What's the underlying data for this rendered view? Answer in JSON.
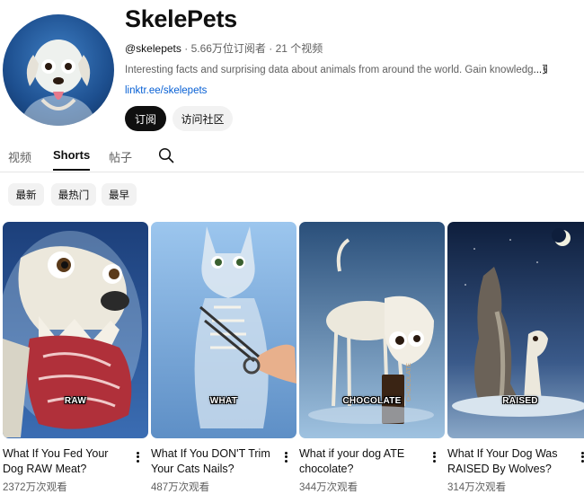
{
  "channel": {
    "name": "SkelePets",
    "handle": "@skelepets",
    "subscribers": "5.66万位订阅者",
    "videos": "21 个视频",
    "separator": "·",
    "description": "Interesting facts and surprising data about animals from around the world. Gain knowledg",
    "more": "...更多",
    "link": "linktr.ee/skelepets"
  },
  "buttons": {
    "subscribe": "订阅",
    "community": "访问社区"
  },
  "tabs": [
    "视频",
    "Shorts",
    "帖子"
  ],
  "active_tab": "Shorts",
  "filters": [
    "最新",
    "最热门",
    "最早"
  ],
  "shorts": [
    {
      "title": "What If You Fed Your Dog RAW Meat?",
      "views": "2372万次观看",
      "overlay": "RAW"
    },
    {
      "title": "What If You DON'T Trim Your Cats Nails?",
      "views": "487万次观看",
      "overlay": "WHAT"
    },
    {
      "title": "What if your dog ATE chocolate?",
      "views": "344万次观看",
      "overlay": "CHOCOLATE",
      "bar_label": "CHOCOLATE"
    },
    {
      "title": "What If Your Dog Was RAISED By Wolves?",
      "views": "314万次观看",
      "overlay": "RAISED"
    }
  ],
  "icons": {
    "search": "search-icon",
    "more": "more-vert-icon"
  }
}
